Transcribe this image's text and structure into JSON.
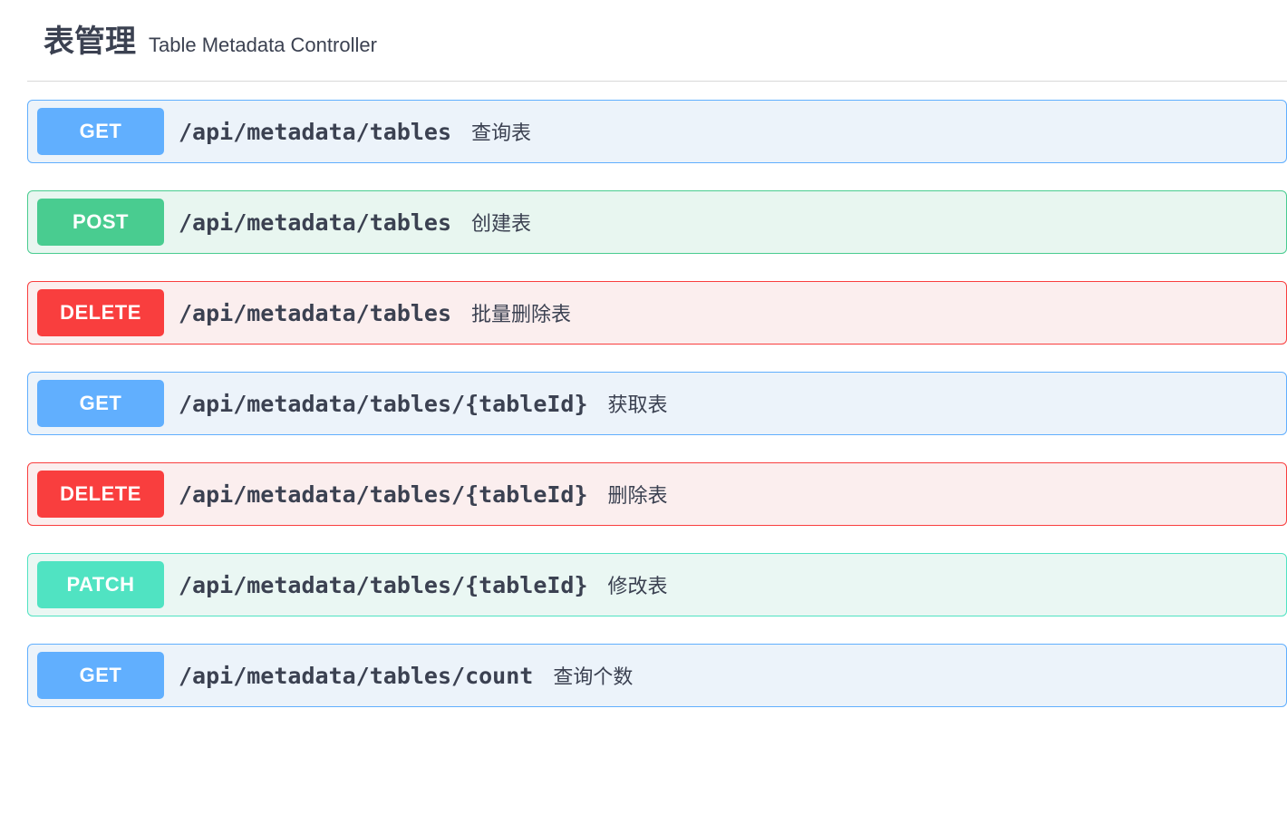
{
  "header": {
    "title": "表管理",
    "subtitle": "Table Metadata Controller"
  },
  "endpoints": [
    {
      "method": "GET",
      "methodClass": "get",
      "badgeClass": "get-badge",
      "path": "/api/metadata/tables",
      "summary": "查询表"
    },
    {
      "method": "POST",
      "methodClass": "post",
      "badgeClass": "post-badge",
      "path": "/api/metadata/tables",
      "summary": "创建表"
    },
    {
      "method": "DELETE",
      "methodClass": "delete",
      "badgeClass": "delete-badge",
      "path": "/api/metadata/tables",
      "summary": "批量删除表"
    },
    {
      "method": "GET",
      "methodClass": "get",
      "badgeClass": "get-badge",
      "path": "/api/metadata/tables/{tableId}",
      "summary": "获取表"
    },
    {
      "method": "DELETE",
      "methodClass": "delete",
      "badgeClass": "delete-badge",
      "path": "/api/metadata/tables/{tableId}",
      "summary": "删除表"
    },
    {
      "method": "PATCH",
      "methodClass": "patch",
      "badgeClass": "patch-badge",
      "path": "/api/metadata/tables/{tableId}",
      "summary": "修改表"
    },
    {
      "method": "GET",
      "methodClass": "get",
      "badgeClass": "get-badge",
      "path": "/api/metadata/tables/count",
      "summary": "查询个数"
    }
  ]
}
